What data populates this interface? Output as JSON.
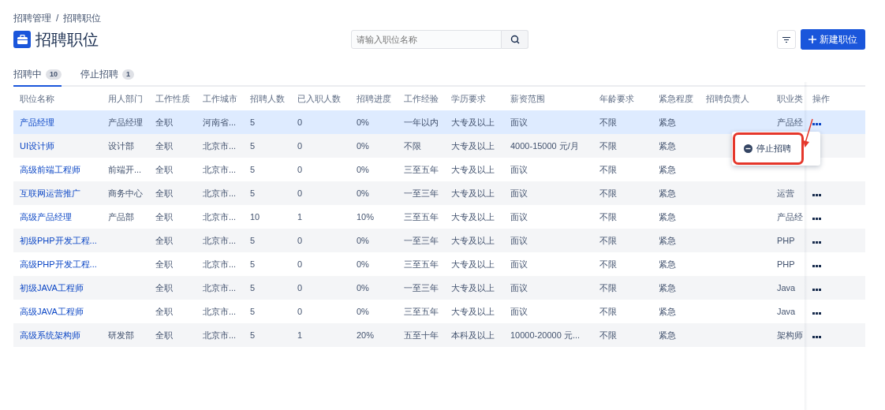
{
  "breadcrumb": [
    "招聘管理",
    "招聘职位"
  ],
  "breadcrumb_separator": "/",
  "title": "招聘职位",
  "search": {
    "placeholder": "请输入职位名称"
  },
  "new_button": {
    "label": "新建职位"
  },
  "tabs": [
    {
      "label": "招聘中",
      "count": "10",
      "selected": true
    },
    {
      "label": "停止招聘",
      "count": "1",
      "selected": false
    }
  ],
  "table": {
    "columns": [
      "职位名称",
      "用人部门",
      "工作性质",
      "工作城市",
      "招聘人数",
      "已入职人数",
      "招聘进度",
      "工作经验",
      "学历要求",
      "薪资范围",
      "年龄要求",
      "紧急程度",
      "招聘负责人",
      "职业类",
      "操作"
    ],
    "rows": [
      {
        "cells": [
          "产品经理",
          "产品经理",
          "全职",
          "河南省...",
          "5",
          "0",
          "0%",
          "一年以内",
          "大专及以上",
          "面议",
          "不限",
          "紧急",
          null,
          "产品经"
        ],
        "selected": true,
        "menu_open": true,
        "actions_covered": false
      },
      {
        "cells": [
          "UI设计师",
          "设计部",
          "全职",
          "北京市...",
          "5",
          "0",
          "0%",
          "不限",
          "大专及以上",
          "4000-15000 元/月",
          "不限",
          "紧急",
          null,
          null
        ],
        "selected": false,
        "menu_open": false,
        "actions_covered": true
      },
      {
        "cells": [
          "高级前端工程师",
          "前端开...",
          "全职",
          "北京市...",
          "5",
          "0",
          "0%",
          "三至五年",
          "大专及以上",
          "面议",
          "不限",
          "紧急",
          null,
          null
        ],
        "selected": false,
        "menu_open": false,
        "actions_covered": true
      },
      {
        "cells": [
          "互联网运营推广",
          "商务中心",
          "全职",
          "北京市...",
          "5",
          "0",
          "0%",
          "一至三年",
          "大专及以上",
          "面议",
          "不限",
          "紧急",
          null,
          "运营"
        ],
        "selected": false,
        "menu_open": false,
        "actions_covered": false
      },
      {
        "cells": [
          "高级产品经理",
          "产品部",
          "全职",
          "北京市...",
          "10",
          "1",
          "10%",
          "三至五年",
          "大专及以上",
          "面议",
          "不限",
          "紧急",
          null,
          "产品经"
        ],
        "selected": false,
        "menu_open": false,
        "actions_covered": false
      },
      {
        "cells": [
          "初级PHP开发工程...",
          null,
          "全职",
          "北京市...",
          "5",
          "0",
          "0%",
          "一至三年",
          "大专及以上",
          "面议",
          "不限",
          "紧急",
          null,
          "PHP"
        ],
        "selected": false,
        "menu_open": false,
        "actions_covered": false
      },
      {
        "cells": [
          "高级PHP开发工程...",
          null,
          "全职",
          "北京市...",
          "5",
          "0",
          "0%",
          "三至五年",
          "大专及以上",
          "面议",
          "不限",
          "紧急",
          null,
          "PHP"
        ],
        "selected": false,
        "menu_open": false,
        "actions_covered": false
      },
      {
        "cells": [
          "初级JAVA工程师",
          null,
          "全职",
          "北京市...",
          "5",
          "0",
          "0%",
          "一至三年",
          "大专及以上",
          "面议",
          "不限",
          "紧急",
          null,
          "Java"
        ],
        "selected": false,
        "menu_open": false,
        "actions_covered": false
      },
      {
        "cells": [
          "高级JAVA工程师",
          null,
          "全职",
          "北京市...",
          "5",
          "0",
          "0%",
          "三至五年",
          "大专及以上",
          "面议",
          "不限",
          "紧急",
          null,
          "Java"
        ],
        "selected": false,
        "menu_open": false,
        "actions_covered": false
      },
      {
        "cells": [
          "高级系统架构师",
          "研发部",
          "全职",
          "北京市...",
          "5",
          "1",
          "20%",
          "五至十年",
          "本科及以上",
          "10000-20000 元...",
          "不限",
          "紧急",
          null,
          "架构师"
        ],
        "selected": false,
        "menu_open": false,
        "actions_covered": false
      }
    ]
  },
  "row_menu": {
    "items": [
      {
        "label": "停止招聘",
        "highlighted": true
      }
    ]
  }
}
